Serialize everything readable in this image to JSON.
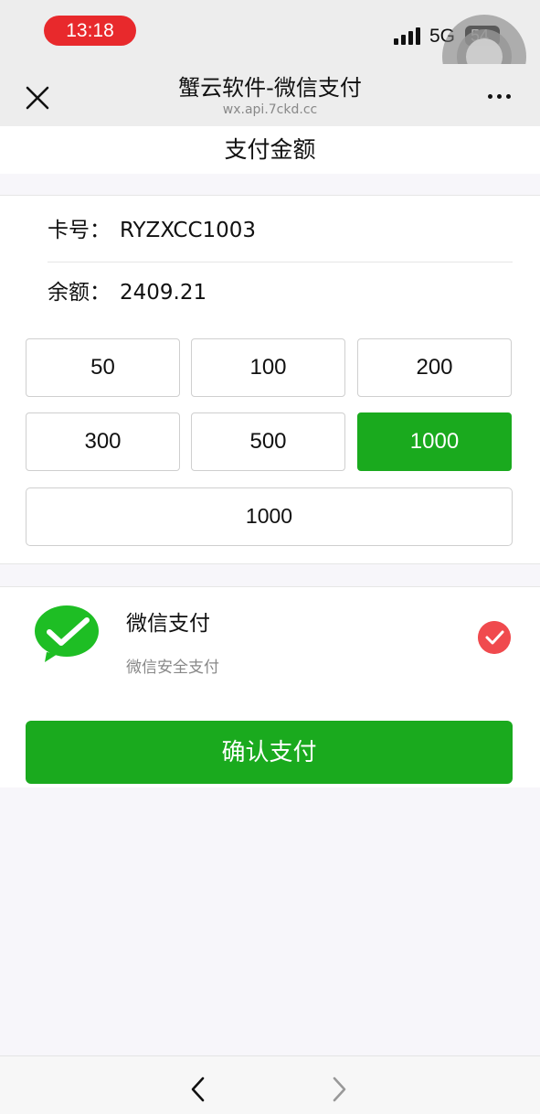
{
  "status_bar": {
    "time": "13:18",
    "network": "5G",
    "battery": "54"
  },
  "nav": {
    "title": "蟹云软件-微信支付",
    "url": "wx.api.7ckd.cc",
    "close_icon": "close-icon",
    "more_icon": "more-icon"
  },
  "page": {
    "section_title": "支付金额"
  },
  "card": {
    "card_label": "卡号：",
    "card_value": "RYZXCC1003",
    "balance_label": "余额：",
    "balance_value": "2409.21"
  },
  "amounts": {
    "options": [
      "50",
      "100",
      "200",
      "300",
      "500",
      "1000"
    ],
    "selected": "1000",
    "custom_value": "1000"
  },
  "payment_method": {
    "name": "微信支付",
    "description": "微信安全支付",
    "icon": "wechat-pay-icon",
    "checked": true
  },
  "actions": {
    "confirm_label": "确认支付"
  },
  "colors": {
    "accent_green": "#1aaa1e",
    "check_red": "#f04a4e",
    "time_pill_red": "#e8292c"
  }
}
